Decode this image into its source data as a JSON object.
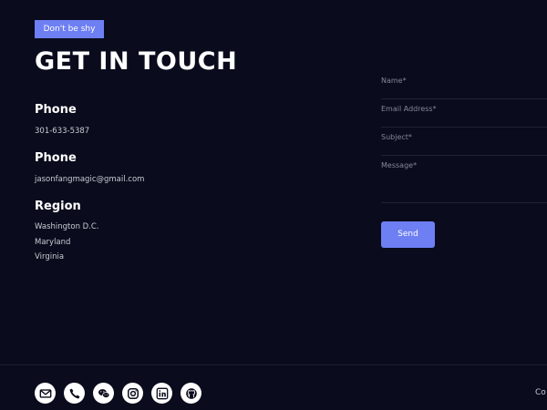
{
  "header": {
    "badge": "Don't be shy",
    "title": "GET IN TOUCH"
  },
  "contact": {
    "phone_heading": "Phone",
    "phone_value": "301-633-5387",
    "email_heading": "Phone",
    "email_value": "jasonfangmagic@gmail.com",
    "region_heading": "Region",
    "regions": [
      "Washington D.C.",
      "Maryland",
      "Virginia"
    ]
  },
  "form": {
    "name_label": "Name*",
    "email_label": "Email Address*",
    "subject_label": "Subject*",
    "message_label": "Message*",
    "send_label": "Send"
  },
  "footer": {
    "social_icons": [
      "email-icon",
      "phone-icon",
      "wechat-icon",
      "instagram-icon",
      "linkedin-icon",
      "github-icon"
    ],
    "copyright_fragment": "Co"
  },
  "colors": {
    "background": "#0a0b1c",
    "accent": "#6e7ff3",
    "text": "#ffffff",
    "muted_text": "#c9cbd6"
  }
}
